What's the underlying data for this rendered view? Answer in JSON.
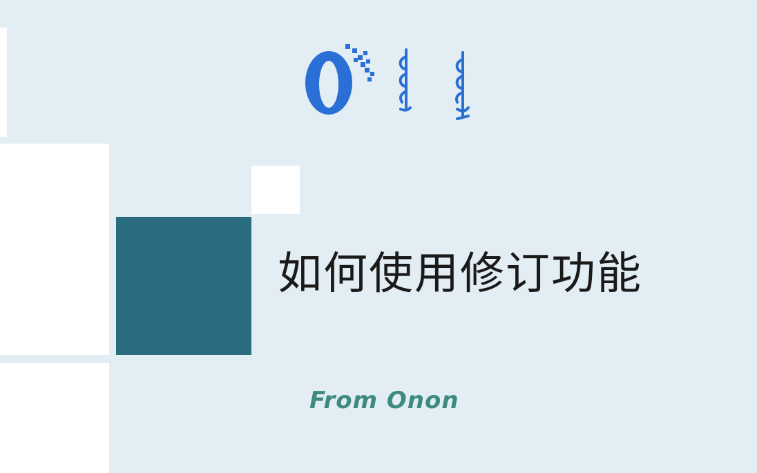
{
  "slide": {
    "title": "如何使用修订功能",
    "subtitle": "From Onon"
  },
  "logo": {
    "icon": "onon-logo-icon",
    "brand_color": "#2a6fd6"
  },
  "colors": {
    "background": "#e3eef4",
    "accent_block": "#2b6b80",
    "subtitle": "#3e8a80",
    "title": "#1a1a1a"
  }
}
